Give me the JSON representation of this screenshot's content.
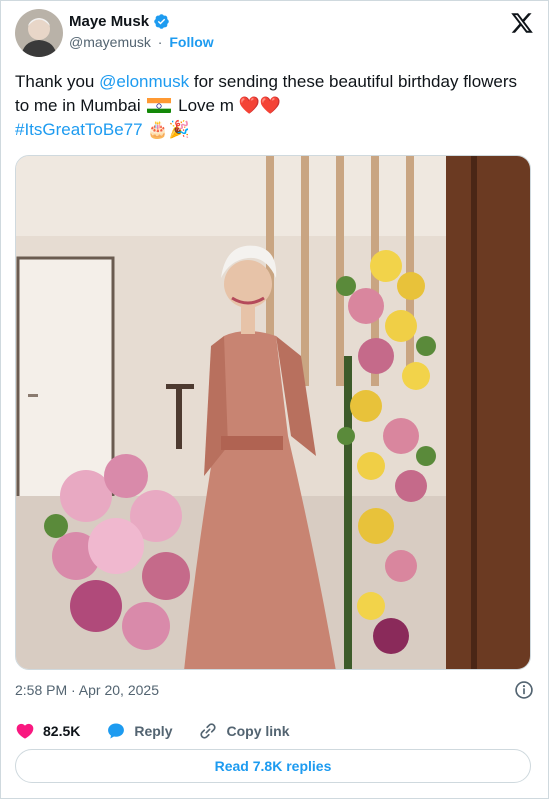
{
  "author": {
    "name": "Maye Musk",
    "handle": "@mayemusk",
    "separator": "·",
    "follow_label": "Follow"
  },
  "tweet": {
    "text_part1": "Thank you ",
    "mention": "@elonmusk",
    "text_part2": " for sending these beautiful birthday flowers to me in Mumbai ",
    "text_part3": " Love m ",
    "hearts": "❤️❤️",
    "hashtag": "#ItsGreatToBe77",
    "emojis": "🎂🎉"
  },
  "meta": {
    "timestamp": "2:58 PM · Apr 20, 2025"
  },
  "actions": {
    "like_count": "82.5K",
    "reply_label": "Reply",
    "copy_link_label": "Copy link"
  },
  "read_replies_label": "Read 7.8K replies",
  "colors": {
    "accent": "#1d9bf0",
    "like": "#f91880",
    "text_primary": "#0f1419",
    "text_secondary": "#536471",
    "border": "#cfd9de"
  },
  "icons": {
    "verified": "verified-badge-icon",
    "brand": "x-logo-icon",
    "info": "info-icon",
    "like": "heart-icon",
    "reply": "reply-bubble-icon",
    "copy_link": "link-icon"
  }
}
